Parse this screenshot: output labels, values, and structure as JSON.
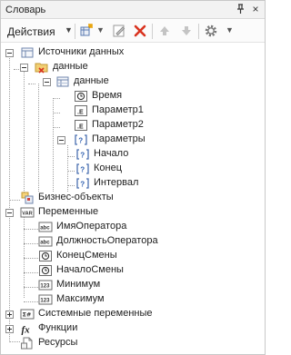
{
  "panel": {
    "title": "Словарь",
    "close_glyph": "×"
  },
  "toolbar": {
    "actions_label": "Действия",
    "actions_caret": "▼",
    "new_caret": "▼",
    "settings_caret": "▼"
  },
  "tree": {
    "data_sources": "Источники данных",
    "data_cat": "данные",
    "data_table": "данные",
    "col_time": "Время",
    "col_param1": "Параметр1",
    "col_param2": "Параметр2",
    "params": "Параметры",
    "param_start": "Начало",
    "param_end": "Конец",
    "param_interval": "Интервал",
    "business_objects": "Бизнес-объекты",
    "variables": "Переменные",
    "var_operator_name": "ИмяОператора",
    "var_operator_position": "ДолжностьОператора",
    "var_shift_end": "КонецСмены",
    "var_shift_start": "НачалоСмены",
    "var_min": "Минимум",
    "var_max": "Максимум",
    "system_variables": "Системные переменные",
    "functions": "Функции",
    "resources": "Ресурсы"
  },
  "icons": {
    "var_string": "abc",
    "var_number": "123",
    "var_sys": "Σ#",
    "var_folder": "VAR",
    "fx": "fx",
    "param": "[?]",
    "field_e": ".E"
  }
}
